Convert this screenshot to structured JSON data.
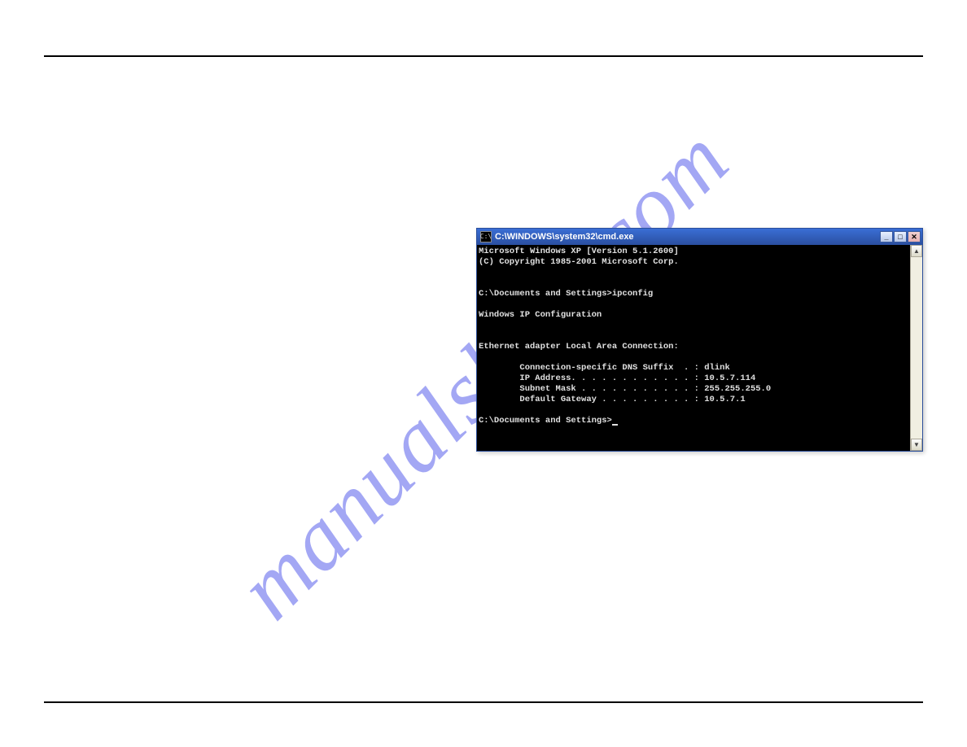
{
  "watermark": "manualshive.com",
  "window": {
    "title": "C:\\WINDOWS\\system32\\cmd.exe"
  },
  "terminal": {
    "header1": "Microsoft Windows XP [Version 5.1.2600]",
    "header2": "(C) Copyright 1985-2001 Microsoft Corp.",
    "prompt_cmd": "C:\\Documents and Settings>ipconfig",
    "ipconfig_title": "Windows IP Configuration",
    "adapter": "Ethernet adapter Local Area Connection:",
    "dns": "        Connection-specific DNS Suffix  . : dlink",
    "ip": "        IP Address. . . . . . . . . . . . : 10.5.7.114",
    "subnet": "        Subnet Mask . . . . . . . . . . . : 255.255.255.0",
    "gateway": "        Default Gateway . . . . . . . . . : 10.5.7.1",
    "prompt_ready": "C:\\Documents and Settings>"
  }
}
